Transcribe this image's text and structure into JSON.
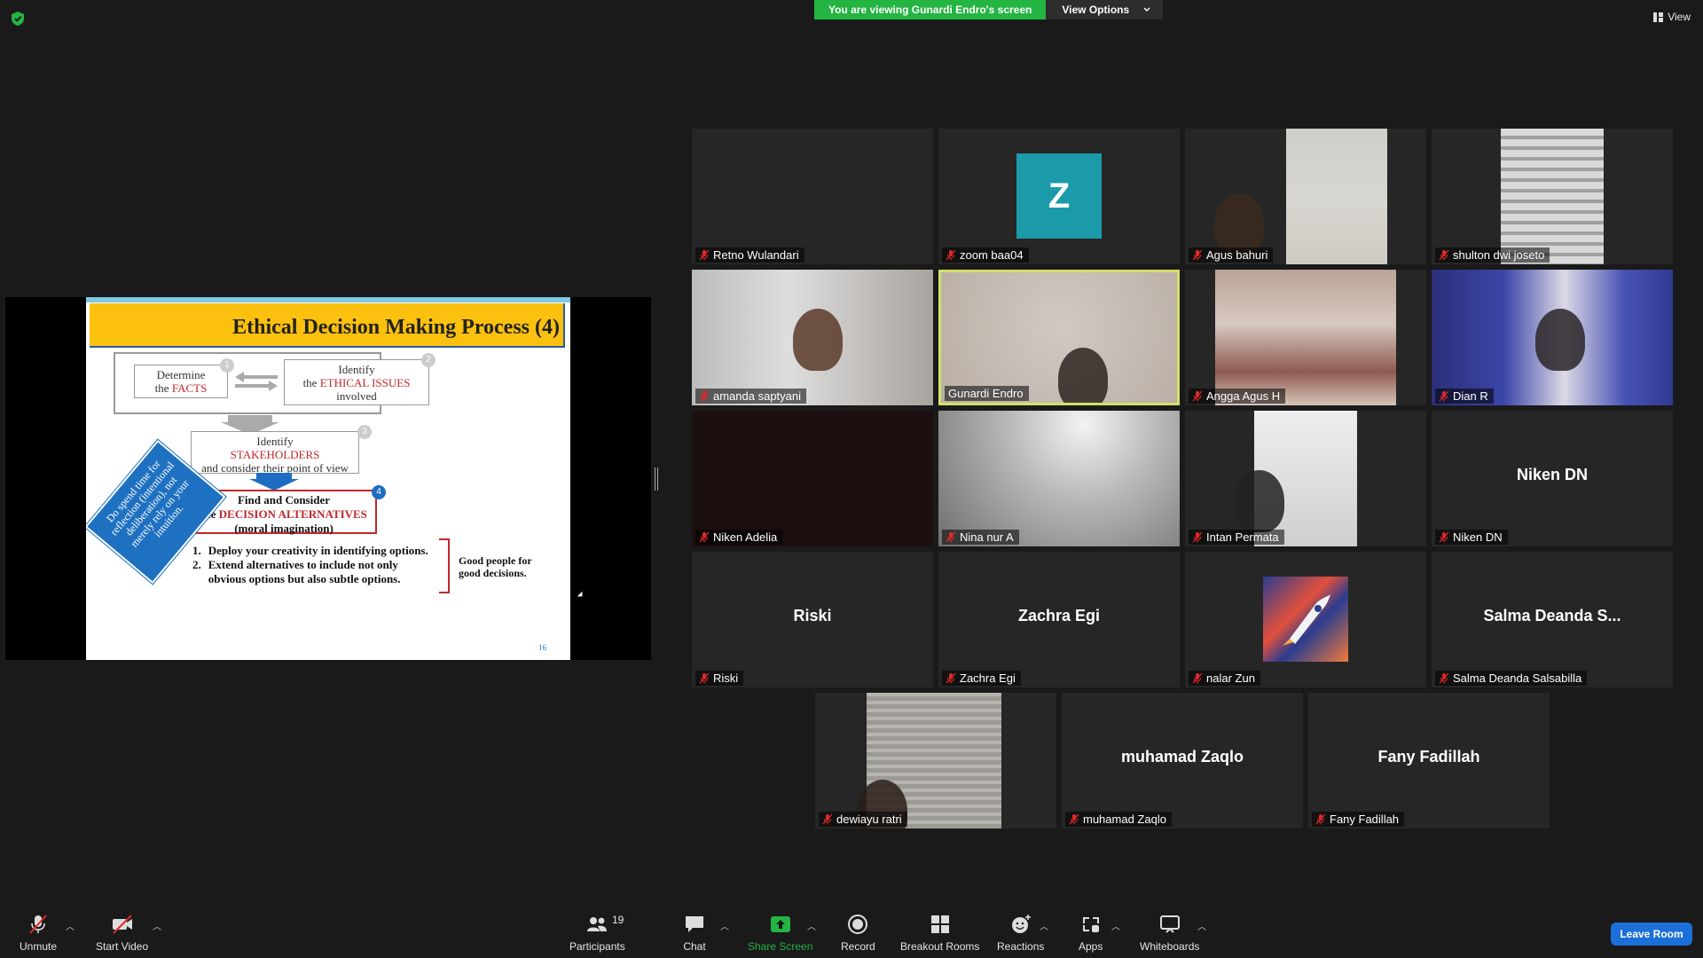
{
  "top": {
    "viewing_banner": "You are viewing Gunardi Endro's screen",
    "view_options": "View Options",
    "view_label": "View"
  },
  "slide": {
    "title": "Ethical Decision Making Process (4)",
    "step1_a": "Determine",
    "step1_b_pre": "the ",
    "step1_b_red": "FACTS",
    "step2_a": "Identify",
    "step2_b_pre": "the ",
    "step2_b_red": "ETHICAL ISSUES",
    "step2_c": "involved",
    "step3_a": "Identify",
    "step3_b_red": "STAKEHOLDERS",
    "step3_c": "and consider their point of view",
    "step4_a": "Find and Consider",
    "step4_b_pre": "the ",
    "step4_b_red": "DECISION ALTERNATIVES",
    "step4_c": "(moral imagination)",
    "n1": "1",
    "n2": "2",
    "n3": "3",
    "n4": "4",
    "diamond_text": "Do spend time for reflection (intentional deliberation), not merely rely on your intuition.",
    "list": [
      {
        "num": "1.",
        "text": "Deploy your creativity in identifying options."
      },
      {
        "num": "2.",
        "text": "Extend alternatives to include not only obvious options but also subtle options."
      }
    ],
    "good_people": "Good people for good decisions.",
    "page_number": "16"
  },
  "participants": [
    {
      "name": "Retno Wulandari"
    },
    {
      "name": "zoom baa04",
      "initial": "Z"
    },
    {
      "name": "Agus bahuri"
    },
    {
      "name": "shulton dwi joseto"
    },
    {
      "name": "amanda saptyani"
    },
    {
      "name": "Gunardi Endro"
    },
    {
      "name": "Angga Agus H"
    },
    {
      "name": "Dian R"
    },
    {
      "name": "Niken Adelia"
    },
    {
      "name": "Nina nur A"
    },
    {
      "name": "Intan Permata"
    },
    {
      "name": "Niken DN",
      "display": "Niken DN"
    },
    {
      "name": "Riski",
      "display": "Riski"
    },
    {
      "name": "Zachra Egi",
      "display": "Zachra Egi"
    },
    {
      "name": "nalar Zun"
    },
    {
      "name": "Salma Deanda Salsabilla",
      "display": "Salma  Deanda  S..."
    },
    {
      "name": "dewiayu ratri"
    },
    {
      "name": "muhamad Zaqlo",
      "display": "muhamad Zaqlo"
    },
    {
      "name": "Fany Fadillah",
      "display": "Fany Fadillah"
    }
  ],
  "toolbar": {
    "unmute": "Unmute",
    "start_video": "Start Video",
    "participants": "Participants",
    "participants_count": "19",
    "chat": "Chat",
    "share_screen": "Share Screen",
    "record": "Record",
    "breakout_rooms": "Breakout Rooms",
    "reactions": "Reactions",
    "apps": "Apps",
    "whiteboards": "Whiteboards",
    "leave": "Leave Room"
  },
  "colors": {
    "share_green": "#23b442",
    "leave_blue": "#1b6fd8",
    "active_speaker": "#d6e06a",
    "slide_header": "#fcc10e",
    "mic_muted_red": "#e02828"
  }
}
